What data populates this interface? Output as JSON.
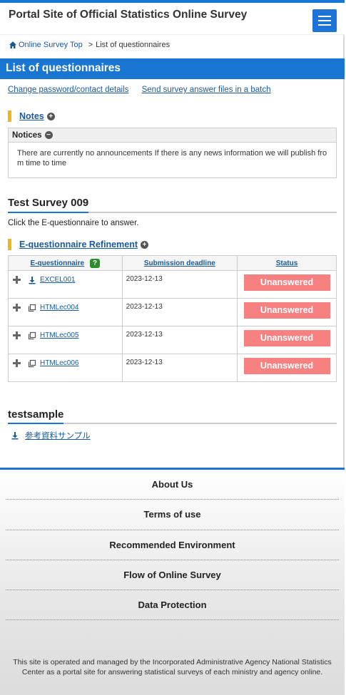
{
  "header": {
    "site_title": "Portal Site of Official Statistics Online Survey",
    "menu_icon": "hamburger-menu-icon"
  },
  "breadcrumb": {
    "home": "Online Survey Top",
    "separator": ">",
    "current": "List of questionnaires"
  },
  "page_title": "List of questionnaires",
  "links": {
    "change_password": "Change password/contact details",
    "send_batch": "Send survey answer files in a batch"
  },
  "notes": {
    "heading": "Notes",
    "notices_label": "Notices",
    "body": "There are currently no announcements If there is any news information we will publish from time to time"
  },
  "survey": {
    "title": "Test Survey 009",
    "instruction": "Click the E-questionnaire to answer.",
    "refinement_heading": "E-questionnaire Refinement",
    "columns": {
      "equestionnaire": "E-questionnaire",
      "help": "?",
      "deadline": "Submission deadline",
      "status": "Status"
    },
    "rows": [
      {
        "name": "EXCEL001",
        "icon": "download-icon",
        "deadline": "2023-12-13",
        "status": "Unanswered"
      },
      {
        "name": "HTMLec004",
        "icon": "window-icon",
        "deadline": "2023-12-13",
        "status": "Unanswered"
      },
      {
        "name": "HTMLec005",
        "icon": "window-icon",
        "deadline": "2023-12-13",
        "status": "Unanswered"
      },
      {
        "name": "HTMLec006",
        "icon": "window-icon",
        "deadline": "2023-12-13",
        "status": "Unanswered"
      }
    ]
  },
  "sample": {
    "title": "testsample",
    "link": "参考資料サンプル"
  },
  "footer": {
    "items": [
      "About Us",
      "Terms of use",
      "Recommended Environment",
      "Flow of Online Survey",
      "Data Protection"
    ],
    "note": "This site is operated and managed by the Incorporated Administrative Agency National Statistics Center as a portal site for answering statistical surveys of each ministry and agency online."
  },
  "colors": {
    "accent": "#1976d2",
    "marker": "#f2b31b",
    "status_unanswered": "#f78080",
    "help_badge": "#2e8b2e",
    "link": "#1a5a9a"
  }
}
